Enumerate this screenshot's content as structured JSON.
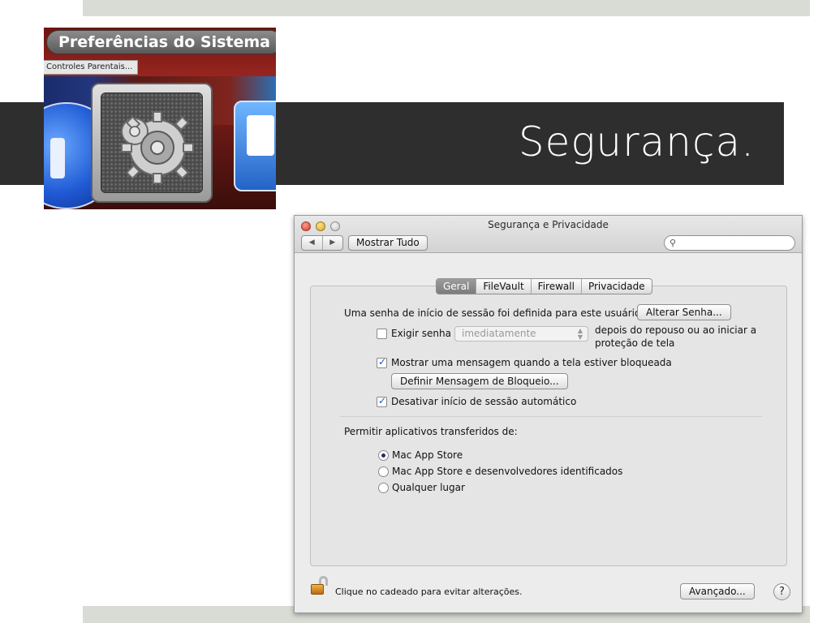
{
  "slide": {
    "title": "Segurança."
  },
  "dock": {
    "tooltip": "Preferências do Sistema",
    "menu_item": "Controles Parentais...",
    "icons": [
      "finder-icon",
      "system-preferences-gear-icon",
      "preview-icon"
    ]
  },
  "window": {
    "title": "Segurança e Privacidade",
    "nav_back": "◀",
    "nav_forward": "▶",
    "show_all_label": "Mostrar Tudo",
    "search": {
      "placeholder": "",
      "value": "",
      "icon": "search-icon"
    },
    "tabs": [
      {
        "label": "Geral",
        "active": true
      },
      {
        "label": "FileVault",
        "active": false
      },
      {
        "label": "Firewall",
        "active": false
      },
      {
        "label": "Privacidade",
        "active": false
      }
    ],
    "general": {
      "password_set_text": "Uma senha de início de sessão foi definida para este usuário",
      "change_password_button": "Alterar Senha...",
      "require_password": {
        "label": "Exigir senha",
        "checked": false,
        "select_value": "imediatamente",
        "suffix_line1": "depois do repouso ou ao iniciar a",
        "suffix_line2": "proteção de tela"
      },
      "show_message": {
        "label": "Mostrar uma mensagem quando a tela estiver bloqueada",
        "checked": true
      },
      "set_lock_message_button": "Definir Mensagem de Bloqueio...",
      "disable_auto_login": {
        "label": "Desativar início de sessão automático",
        "checked": true
      },
      "allow_apps_heading": "Permitir aplicativos transferidos de:",
      "allow_options": [
        {
          "label": "Mac App Store",
          "selected": true
        },
        {
          "label": "Mac App Store e desenvolvedores identificados",
          "selected": false
        },
        {
          "label": "Qualquer lugar",
          "selected": false
        }
      ]
    },
    "footer": {
      "lock_text": "Clique no cadeado para evitar alterações.",
      "advanced_button": "Avançado...",
      "help_button": "?"
    }
  },
  "colors": {
    "band": "#2e2e2e",
    "stripe": "#d9dcd4",
    "window_bg": "#ececec",
    "check_accent": "#1f57c9"
  }
}
